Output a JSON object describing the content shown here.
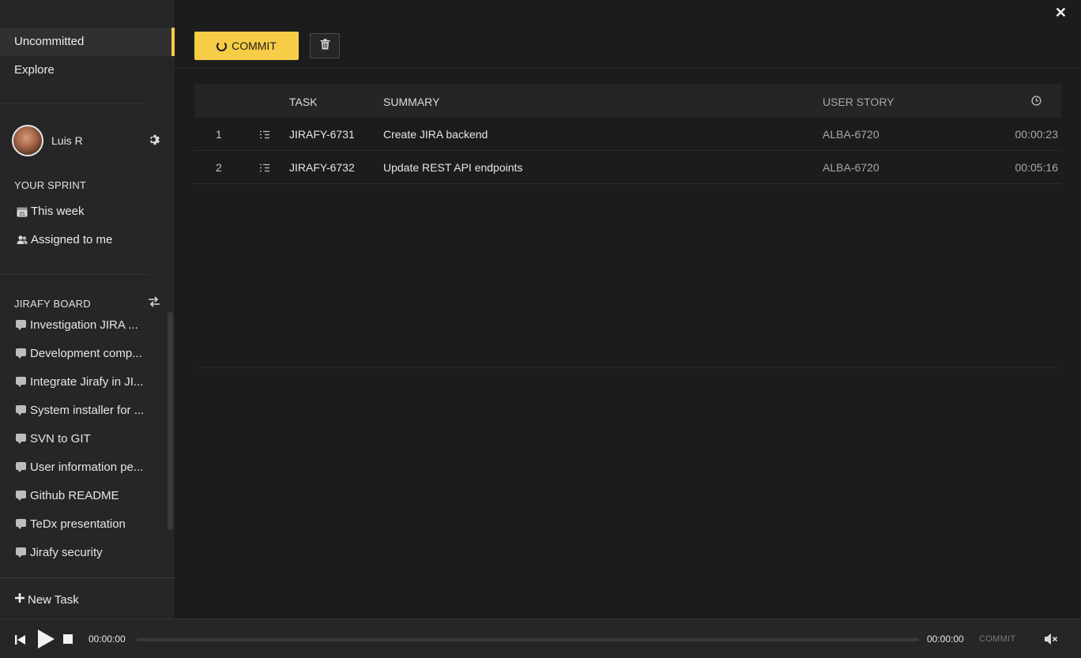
{
  "sidebar": {
    "nav": [
      {
        "label": "Uncommitted",
        "active": true
      },
      {
        "label": "Explore",
        "active": false
      }
    ],
    "user": {
      "name": "Luis R",
      "settings_icon": "gear-icon"
    },
    "sprint": {
      "title": "YOUR SPRINT",
      "items": [
        {
          "label": "This week",
          "icon": "calendar-icon"
        },
        {
          "label": "Assigned to me",
          "icon": "users-icon"
        }
      ]
    },
    "board": {
      "title": "JIRAFY BOARD",
      "switch_icon": "swap-icon",
      "items": [
        {
          "label": "Investigation JIRA ..."
        },
        {
          "label": "Development comp..."
        },
        {
          "label": "Integrate Jirafy in JI..."
        },
        {
          "label": "System installer for ..."
        },
        {
          "label": "SVN to GIT"
        },
        {
          "label": "User information pe..."
        },
        {
          "label": "Github README"
        },
        {
          "label": "TeDx presentation"
        },
        {
          "label": "Jirafy security"
        }
      ]
    },
    "new_task": "New Task"
  },
  "toolbar": {
    "commit_label": "COMMIT",
    "accent": "#f7cd47"
  },
  "table": {
    "columns": {
      "task": "TASK",
      "summary": "SUMMARY",
      "user_story": "USER STORY",
      "time_icon": "clock-icon"
    },
    "rows": [
      {
        "num": "1",
        "task": "JIRAFY-6731",
        "summary": "Create JIRA backend",
        "user_story": "ALBA-6720",
        "time": "00:00:23"
      },
      {
        "num": "2",
        "task": "JIRAFY-6732",
        "summary": "Update REST API endpoints",
        "user_story": "ALBA-6720",
        "time": "00:05:16"
      }
    ]
  },
  "player": {
    "time_start": "00:00:00",
    "time_end": "00:00:00",
    "commit_label": "COMMIT",
    "progress": 0
  }
}
